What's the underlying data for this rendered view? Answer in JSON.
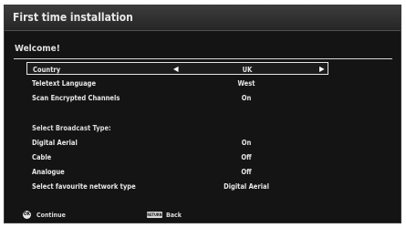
{
  "window": {
    "title": "First time installation"
  },
  "welcome": "Welcome!",
  "country": {
    "label": "Country",
    "value": "UK"
  },
  "teletext": {
    "label": "Teletext Language",
    "value": "West"
  },
  "encrypted": {
    "label": "Scan Encrypted Channels",
    "value": "On"
  },
  "broadcast_heading": "Select Broadcast Type:",
  "digital_aerial": {
    "label": "Digital Aerial",
    "value": "On"
  },
  "cable": {
    "label": "Cable",
    "value": "Off"
  },
  "analogue": {
    "label": "Analogue",
    "value": "Off"
  },
  "network": {
    "label": "Select favourite network type",
    "value": "Digital Aerial"
  },
  "footer": {
    "ok_icon_text": "OK",
    "continue": "Continue",
    "return_icon_text": "RETURN",
    "back": "Back"
  },
  "icons": {
    "left_arrow": "◀",
    "right_arrow": "▶"
  }
}
